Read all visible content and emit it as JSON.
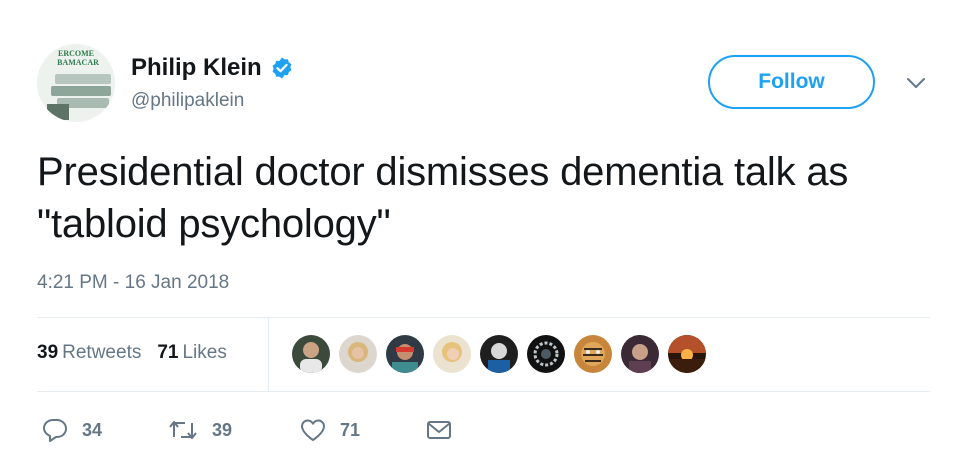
{
  "user": {
    "display_name": "Philip Klein",
    "handle": "@philipaklein",
    "verified": true,
    "avatar_text": [
      "ERCOME",
      "BAMACAR"
    ]
  },
  "header": {
    "follow_label": "Follow"
  },
  "tweet": {
    "text": "Presidential doctor dismisses dementia talk as \"tabloid psychology\"",
    "timestamp": "4:21 PM - 16 Jan 2018"
  },
  "stats": {
    "retweets_count": "39",
    "retweets_label": "Retweets",
    "likes_count": "71",
    "likes_label": "Likes"
  },
  "likers": [
    "liker-1",
    "liker-2",
    "liker-3",
    "liker-4",
    "liker-5",
    "liker-6",
    "liker-7",
    "liker-8",
    "liker-9"
  ],
  "actions": {
    "reply_count": "34",
    "retweet_count": "39",
    "like_count": "71"
  },
  "colors": {
    "accent": "#1da1f2",
    "muted": "#657786",
    "text": "#14171a",
    "divider": "#e6ecf0"
  }
}
